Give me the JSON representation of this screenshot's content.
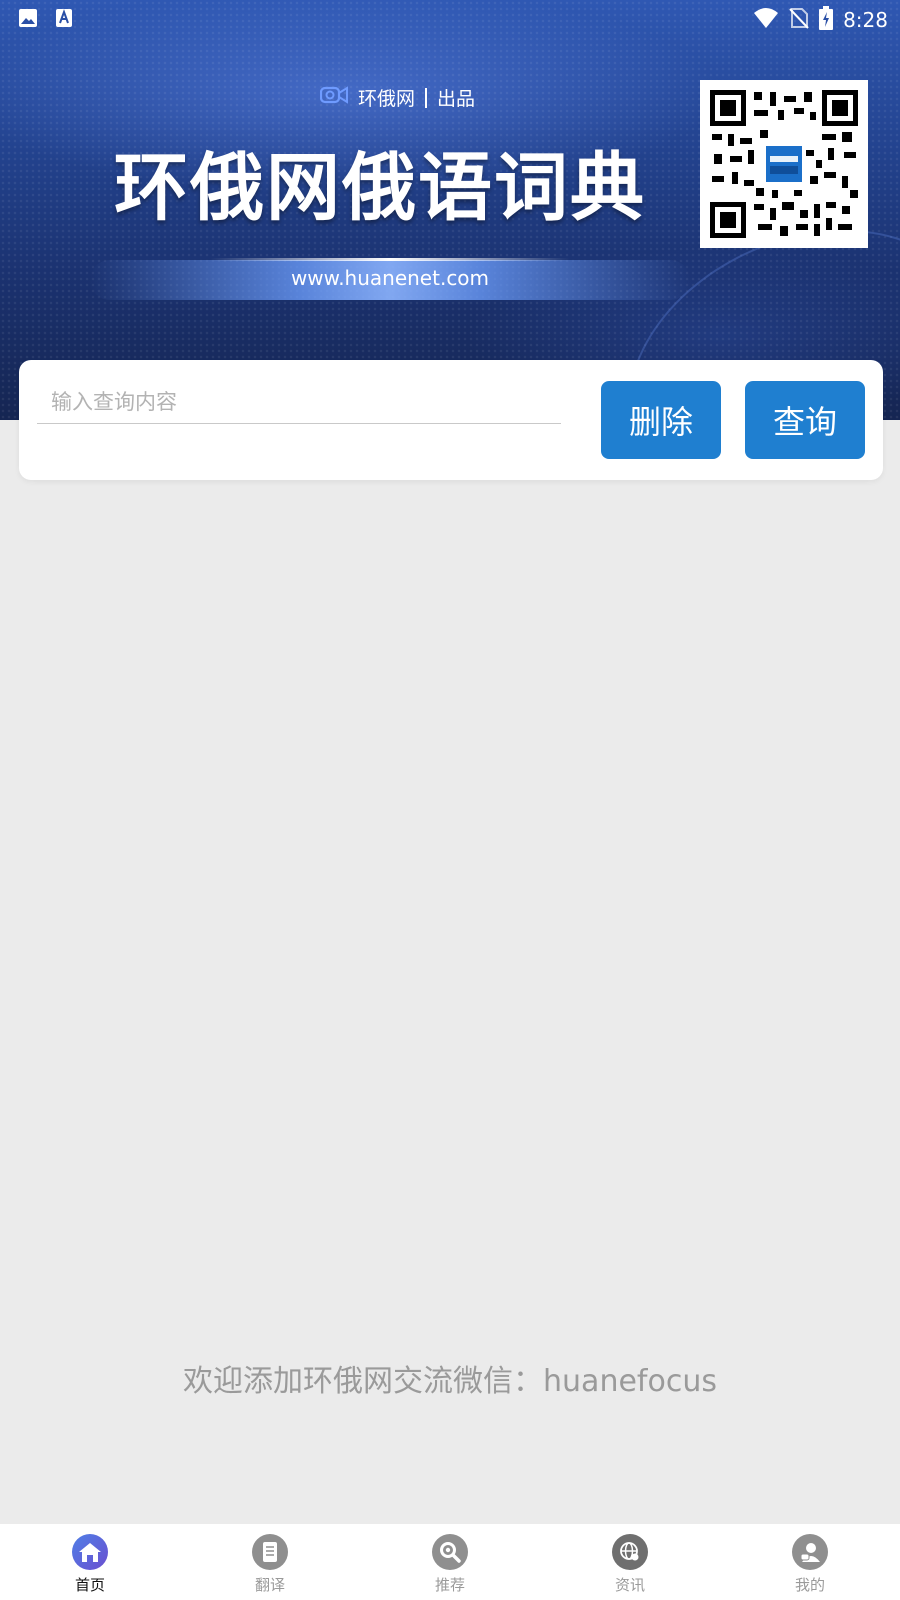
{
  "status_bar": {
    "time": "8:28",
    "left_icons": [
      "image-icon",
      "font-a-icon"
    ],
    "right_icons": [
      "wifi-icon",
      "no-sim-icon",
      "battery-charging-icon"
    ]
  },
  "banner": {
    "brand_name": "环俄网",
    "brand_suffix": "出品",
    "title": "环俄网俄语词典",
    "url": "www.huanenet.com"
  },
  "search": {
    "placeholder": "输入查询内容",
    "value": "",
    "delete_label": "删除",
    "query_label": "查询"
  },
  "welcome_text": "欢迎添加环俄网交流微信：huanefocus",
  "bottom_nav": {
    "items": [
      {
        "label": "首页",
        "icon": "home-icon",
        "active": true
      },
      {
        "label": "翻译",
        "icon": "document-icon",
        "active": false
      },
      {
        "label": "推荐",
        "icon": "search-icon",
        "active": false
      },
      {
        "label": "资讯",
        "icon": "globe-icon",
        "active": false
      },
      {
        "label": "我的",
        "icon": "user-icon",
        "active": false
      }
    ]
  },
  "colors": {
    "accent": "#1f7fd0",
    "banner_dark": "#152552",
    "banner_light": "#2f58b3",
    "page_bg": "#ebebeb"
  }
}
